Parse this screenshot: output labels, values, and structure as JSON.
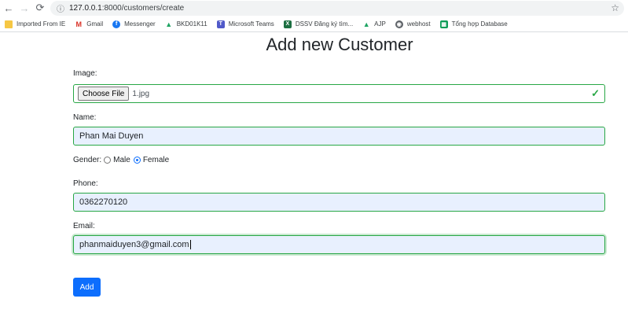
{
  "browser": {
    "url_host": "127.0.0.1",
    "url_rest": ":8000/customers/create",
    "bookmarks": [
      {
        "label": "Imported From IE",
        "icon": "folder-icon"
      },
      {
        "label": "Gmail",
        "icon": "gmail-icon"
      },
      {
        "label": "Messenger",
        "icon": "facebook-icon"
      },
      {
        "label": "BKD01K11",
        "icon": "drive-icon"
      },
      {
        "label": "Microsoft Teams",
        "icon": "teams-icon"
      },
      {
        "label": "DSSV Đăng ký tìm...",
        "icon": "excel-icon"
      },
      {
        "label": "AJP",
        "icon": "drive-icon"
      },
      {
        "label": "webhost",
        "icon": "globe-icon"
      },
      {
        "label": "Tổng hợp Database",
        "icon": "sheets-icon"
      }
    ]
  },
  "page": {
    "title": "Add new Customer"
  },
  "form": {
    "image_label": "Image:",
    "choose_file_label": "Choose File",
    "file_name": "1.jpg",
    "name_label": "Name:",
    "name_value": "Phan Mai Duyen",
    "gender_label": "Gender:",
    "gender_male": "Male",
    "gender_female": "Female",
    "gender_selected": "Female",
    "phone_label": "Phone:",
    "phone_value": "0362270120",
    "email_label": "Email:",
    "email_value": "phanmaiduyen3@gmail.com",
    "submit_label": "Add"
  },
  "colors": {
    "valid_border": "#28a745",
    "primary": "#0d6efd",
    "autofill_bg": "#e8f0fe"
  }
}
